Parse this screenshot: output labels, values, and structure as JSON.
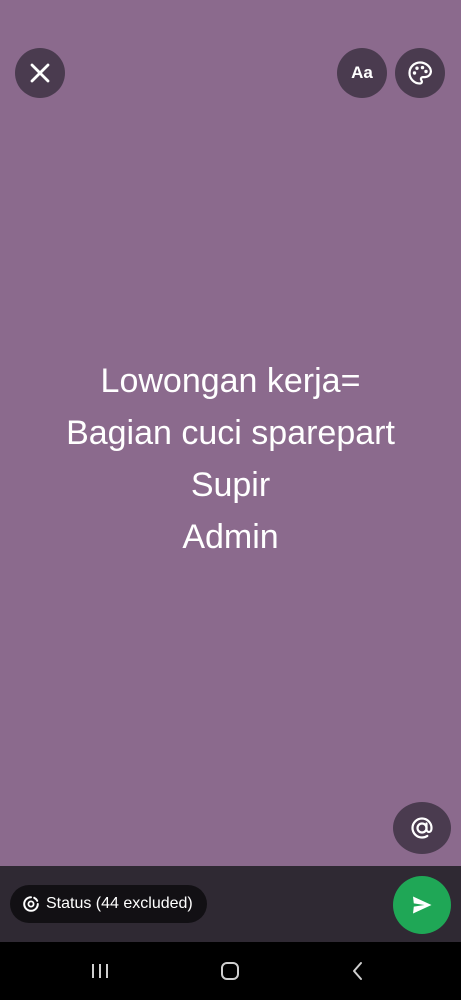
{
  "status_editor": {
    "text_lines": [
      "Lowongan kerja=",
      "Bagian cuci sparepart",
      "Supir",
      "Admin"
    ],
    "background_color": "#8b6a8d"
  },
  "toolbar": {
    "close_icon": "close-icon",
    "font_button_label": "Aa",
    "palette_icon": "palette-icon",
    "mention_icon": "at-sign-icon"
  },
  "bottom_bar": {
    "audience_label": "Status (44 excluded)",
    "audience_icon": "status-ring-icon",
    "send_icon": "send-icon",
    "send_color": "#1fa756"
  },
  "nav_bar": {
    "recent_icon": "recent-apps-icon",
    "home_icon": "home-icon",
    "back_icon": "back-icon"
  }
}
